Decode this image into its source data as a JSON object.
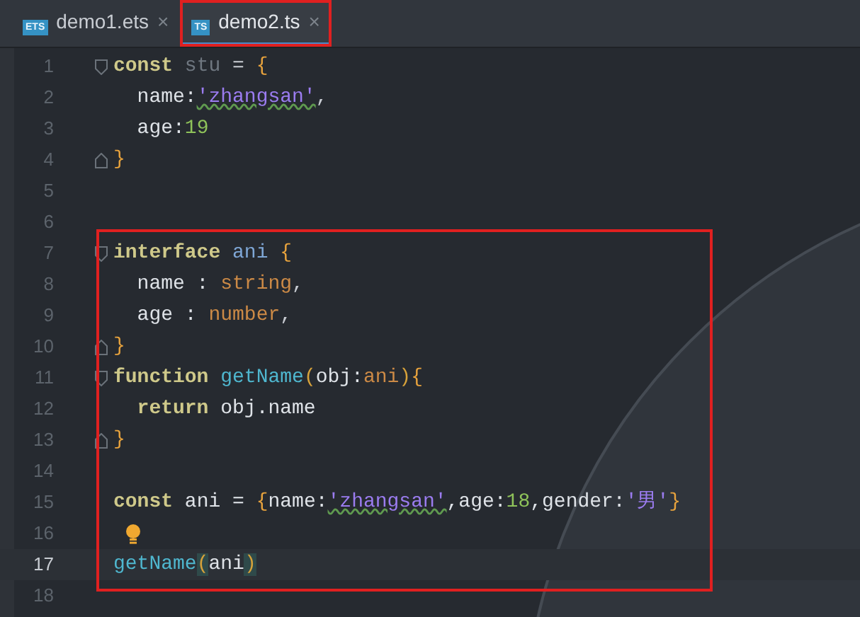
{
  "tabs": [
    {
      "icon_label": "ETS",
      "label": "demo1.ets",
      "close": "×",
      "selected": false,
      "boxed": false
    },
    {
      "icon_label": "TS",
      "label": "demo2.ts",
      "close": "×",
      "selected": true,
      "boxed": true
    }
  ],
  "lines": [
    {
      "number": "1",
      "fold_start": true,
      "fold_end": false,
      "boxed": false,
      "current": false,
      "hint": false,
      "tokens": [
        {
          "kind": "keyword",
          "text": "const "
        },
        {
          "kind": "unused",
          "text": "stu"
        },
        {
          "kind": "punct",
          "text": " = "
        },
        {
          "kind": "brace",
          "text": "{"
        }
      ]
    },
    {
      "number": "2",
      "fold_start": false,
      "fold_end": false,
      "boxed": false,
      "current": false,
      "hint": false,
      "tokens": [
        {
          "kind": "plain",
          "text": "  name:"
        },
        {
          "kind": "string",
          "text": "'zhangsan'",
          "squiggle": true
        },
        {
          "kind": "punct",
          "text": ","
        }
      ]
    },
    {
      "number": "3",
      "fold_start": false,
      "fold_end": false,
      "boxed": false,
      "current": false,
      "hint": false,
      "tokens": [
        {
          "kind": "plain",
          "text": "  age:"
        },
        {
          "kind": "number",
          "text": "19"
        }
      ]
    },
    {
      "number": "4",
      "fold_start": false,
      "fold_end": true,
      "boxed": false,
      "current": false,
      "hint": false,
      "tokens": [
        {
          "kind": "brace",
          "text": "}"
        }
      ]
    },
    {
      "number": "5",
      "fold_start": false,
      "fold_end": false,
      "boxed": false,
      "current": false,
      "hint": false
    },
    {
      "number": "6",
      "fold_start": false,
      "fold_end": false,
      "boxed": false,
      "current": false,
      "hint": false
    },
    {
      "number": "7",
      "fold_start": true,
      "fold_end": false,
      "boxed": true,
      "current": false,
      "hint": false,
      "tokens": [
        {
          "kind": "keyword",
          "text": "interface "
        },
        {
          "kind": "typename",
          "text": "ani "
        },
        {
          "kind": "brace",
          "text": "{"
        }
      ]
    },
    {
      "number": "8",
      "fold_start": false,
      "fold_end": false,
      "boxed": true,
      "current": false,
      "hint": false,
      "tokens": [
        {
          "kind": "plain",
          "text": "  name : "
        },
        {
          "kind": "type",
          "text": "string"
        },
        {
          "kind": "punct",
          "text": ","
        }
      ]
    },
    {
      "number": "9",
      "fold_start": false,
      "fold_end": false,
      "boxed": true,
      "current": false,
      "hint": false,
      "tokens": [
        {
          "kind": "plain",
          "text": "  age : "
        },
        {
          "kind": "type",
          "text": "number"
        },
        {
          "kind": "punct",
          "text": ","
        }
      ]
    },
    {
      "number": "10",
      "fold_start": false,
      "fold_end": true,
      "boxed": true,
      "current": false,
      "hint": false,
      "tokens": [
        {
          "kind": "brace",
          "text": "}"
        }
      ]
    },
    {
      "number": "11",
      "fold_start": true,
      "fold_end": false,
      "boxed": true,
      "current": false,
      "hint": false,
      "tokens": [
        {
          "kind": "keyword",
          "text": "function "
        },
        {
          "kind": "func",
          "text": "getName"
        },
        {
          "kind": "paren",
          "text": "("
        },
        {
          "kind": "plain",
          "text": "obj:"
        },
        {
          "kind": "type",
          "text": "ani"
        },
        {
          "kind": "paren",
          "text": ")"
        },
        {
          "kind": "brace",
          "text": "{"
        }
      ]
    },
    {
      "number": "12",
      "fold_start": false,
      "fold_end": false,
      "boxed": true,
      "current": false,
      "hint": false,
      "tokens": [
        {
          "kind": "keyword",
          "text": "  return "
        },
        {
          "kind": "plain",
          "text": "obj.name"
        }
      ]
    },
    {
      "number": "13",
      "fold_start": false,
      "fold_end": true,
      "boxed": true,
      "current": false,
      "hint": false,
      "tokens": [
        {
          "kind": "brace",
          "text": "}"
        }
      ]
    },
    {
      "number": "14",
      "fold_start": false,
      "fold_end": false,
      "boxed": true,
      "current": false,
      "hint": false
    },
    {
      "number": "15",
      "fold_start": false,
      "fold_end": false,
      "boxed": true,
      "current": false,
      "hint": false,
      "tokens": [
        {
          "kind": "keyword",
          "text": "const "
        },
        {
          "kind": "plain",
          "text": "ani = "
        },
        {
          "kind": "brace",
          "text": "{"
        },
        {
          "kind": "plain",
          "text": "name:"
        },
        {
          "kind": "string",
          "text": "'zhangsan'",
          "squiggle": true
        },
        {
          "kind": "plain",
          "text": ",age:"
        },
        {
          "kind": "number",
          "text": "18"
        },
        {
          "kind": "plain",
          "text": ",gender:"
        },
        {
          "kind": "string",
          "text": "'男'"
        },
        {
          "kind": "brace",
          "text": "}"
        }
      ]
    },
    {
      "number": "16",
      "fold_start": false,
      "fold_end": false,
      "boxed": true,
      "current": false,
      "hint": true
    },
    {
      "number": "17",
      "fold_start": false,
      "fold_end": false,
      "boxed": true,
      "current": true,
      "hint": false,
      "tokens": [
        {
          "kind": "func",
          "text": "getName"
        },
        {
          "kind": "paren",
          "text": "(",
          "matched": true
        },
        {
          "kind": "plain",
          "text": "ani"
        },
        {
          "kind": "paren",
          "text": ")",
          "matched": true
        }
      ]
    },
    {
      "number": "18",
      "fold_start": false,
      "fold_end": false,
      "boxed": false,
      "current": false,
      "hint": false
    }
  ]
}
